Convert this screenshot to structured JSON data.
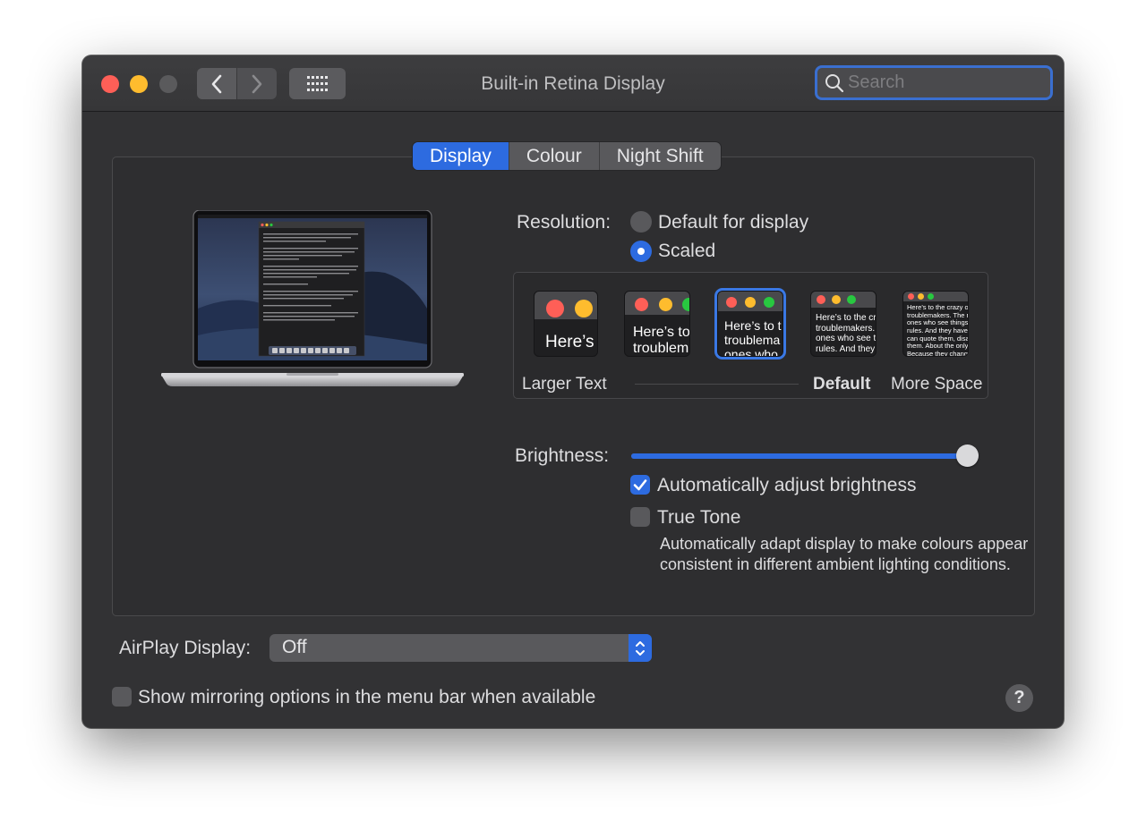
{
  "window": {
    "title": "Built-in Retina Display",
    "search_placeholder": "Search"
  },
  "tabs": [
    {
      "label": "Display",
      "active": true
    },
    {
      "label": "Colour",
      "active": false
    },
    {
      "label": "Night Shift",
      "active": false
    }
  ],
  "resolution": {
    "label": "Resolution:",
    "options": [
      {
        "label": "Default for display",
        "selected": false
      },
      {
        "label": "Scaled",
        "selected": true
      }
    ],
    "scaled_options": [
      {
        "preview_text": "Here’s",
        "selected": false
      },
      {
        "preview_text": "Here’s to\ntroublem",
        "selected": false
      },
      {
        "preview_text": "Here’s to t\ntroublema\nones who",
        "selected": true
      },
      {
        "preview_text": "Here’s to the cr\ntroublemakers.\nones who see t\nrules. And they",
        "selected": false
      },
      {
        "preview_text": "Here’s to the crazy one\ntroublemakers. The rou\nones who see things dif\nrules. And they have no\ncan quote them, disagre\nthem. About the only th\nBecause they change th",
        "selected": false
      }
    ],
    "scale_labels": {
      "left": "Larger Text",
      "default": "Default",
      "right": "More Space"
    }
  },
  "brightness": {
    "label": "Brightness:",
    "value": 1.0,
    "auto_adjust": {
      "label": "Automatically adjust brightness",
      "checked": true
    },
    "true_tone": {
      "label": "True Tone",
      "checked": false,
      "description": "Automatically adapt display to make colours appear consistent in different ambient lighting conditions."
    }
  },
  "airplay": {
    "label": "AirPlay Display:",
    "selected": "Off"
  },
  "mirroring": {
    "label": "Show mirroring options in the menu bar when available",
    "checked": false
  },
  "help_label": "?",
  "colors": {
    "accent": "#2d6be0",
    "window_bg": "#323234",
    "close": "#fe5f57",
    "minimize": "#febc2e"
  }
}
